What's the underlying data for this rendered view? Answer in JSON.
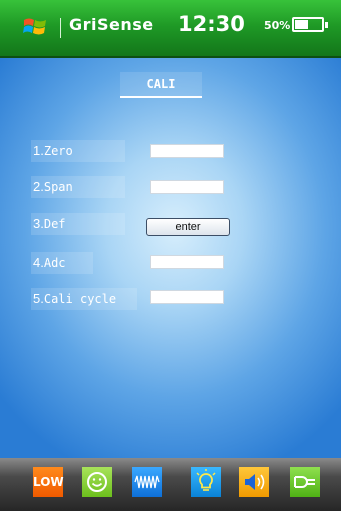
{
  "header": {
    "app_title": "GriSense",
    "time": "12:30",
    "battery_percent_label": "50%",
    "battery_level": 0.5,
    "logo_icon": "windows-logo-icon"
  },
  "screen": {
    "title": "CALI"
  },
  "rows": [
    {
      "number": "1.",
      "label": "Zero",
      "value": ""
    },
    {
      "number": "2.",
      "label": "Span",
      "value": ""
    },
    {
      "number": "3.",
      "label": "Def",
      "button": "enter"
    },
    {
      "number": "4.",
      "label": "Adc",
      "value": ""
    },
    {
      "number": "5.",
      "label": "Cali cycle",
      "value": ""
    }
  ],
  "bottom_bar": [
    {
      "icon": "low-icon",
      "label": "LOW"
    },
    {
      "icon": "smiley-icon"
    },
    {
      "icon": "waveform-icon"
    },
    {
      "icon": "lightbulb-icon"
    },
    {
      "icon": "speaker-icon"
    },
    {
      "icon": "power-plug-icon"
    }
  ],
  "colors": {
    "header_green": "#1f9a26",
    "main_blue": "#2a7cd4",
    "low_orange": "#f05a00"
  }
}
